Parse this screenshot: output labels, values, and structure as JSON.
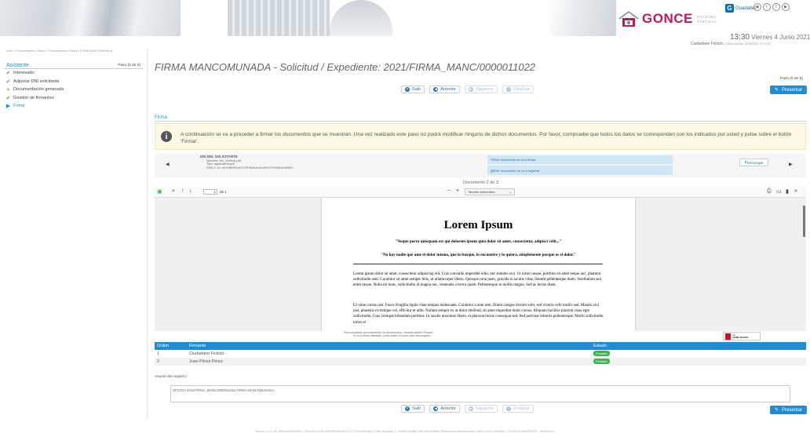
{
  "header": {
    "brand": "GONCE",
    "brand_sub_1": "OFICINA",
    "brand_sub_2": "VIRTUAL",
    "guadaltel": "Guadaltel",
    "guadaltel_icon": "G",
    "social_icons": [
      "rss-icon",
      "twitter-icon",
      "facebook-icon",
      "youtube-icon"
    ],
    "time": "13:30",
    "date": "Viernes 4 Junio 2021",
    "user": "Ciudadano Ficticio",
    "last_access": "| Último acceso: 02/06/2021 17:14:52",
    "breadcrumb": "Inicio » Procedimientos Oficina » Procedimientos Oficina » FIRMA MANCOMUNADA",
    "accent": "#1f8dd6",
    "brand_color": "#c2185b"
  },
  "sidebar": {
    "title": "Asistente",
    "step": "Paso (5 de 5)",
    "items": [
      {
        "label": "Interesado",
        "icon": "check-icon",
        "status": "done"
      },
      {
        "label": "Adjuntar DNI solicitante",
        "icon": "check-icon",
        "status": "done"
      },
      {
        "label": "Documentación generada",
        "icon": "warning-dot-icon",
        "status": "warning"
      },
      {
        "label": "Gestión de firmantes",
        "icon": "check-icon",
        "status": "done"
      },
      {
        "label": "Firma",
        "icon": "play-icon",
        "status": "current"
      }
    ]
  },
  "main": {
    "title": "FIRMA MANCOMUNADA - Solicitud / Expediente: 2021/FIRMA_MANC/0000011022",
    "step": "Paso (5 de 5)",
    "buttons": {
      "salir": "Salir",
      "anterior": "Anterior",
      "siguiente": "Siguiente",
      "finalizar": "Finalizar",
      "presentar": "Presentar"
    },
    "section": "Firma",
    "alert": "A continuación se va a proceder a firmar los documentos que se muestran. Una vez realizado este paso no podrá modificar ninguno de dichos documentos. Por favor, compruebe que todos los datos se corresponden con los indicados por usted y pulse sobre el botón 'Firmar'.",
    "document": {
      "name": "DNI DEL SOLICITANTE",
      "file": "Nombre: dni_Vertical.pdf",
      "type": "Tipo: application/pdf",
      "hash": "SHA-1: m+ok+f9fkXRczECOE9MbolmDxXHzY7HNIDoLWiDk=",
      "firmar": "Este documento se va a firmar",
      "registrar": "Este documento se va a registrar",
      "descargar": "Descargar",
      "counter": "Documento 2 de 3"
    },
    "pdf": {
      "page": "1",
      "of": "de 1",
      "zoom": "Tamaño automático",
      "heading": "Lorem Ipsum",
      "quote1": "\"Neque porro quisquam est qui dolorem ipsum quia dolor sit amet, consectetur, adipisci velit...\"",
      "quote2": "\"No hay nadie que ame el dolor mismo, que lo busque, lo encuentre y lo quiera, simplemente porque es el dolor.\"",
      "para1": "Lorem ipsum dolor sit amet, consectetur adipiscing elit. Cras convallis imperdiet odio, nec sodales orci. Ut tortor neque, porttitor sit amet neque nec, pharetra sollicitudin sem. Curabitur sit amet semper felis, ut ullamcorper libero. Quisque urna justo, gravida in iaculis vitae, blandit pellentesque diam. Vestibulum sed enim neque. Nulla mi nunc, sollicitudin id magna nec, venenatis viverra quam. Pellentesque in mollis magna. Sed ac lectus diam.",
      "para2": "Ut vitae cursus nisl. Fusce fringilla ligula vitae tempus malesuada. Curabitur a ante sem. Etiam congue dictum velit, sed viverra velit mollis sed. Mauris orci nisl, pharetra et tristique vel, efficitur et nibh. Nullam tempor ex ut dolor eleifend, sit amet imperdiet dolor cursus. Aliquam facilisis placerat risus eget sollicitudin. Cras volutpat bibendum porttitor. In iaculis maximus libero, et placerat lectus consequat sed. Sed pulvinar lobortis pellentesque. Morbi sollicitudin tortor et",
      "footer1": "Para visualizar correctamente los documentos, necesita Adobe Reader.",
      "footer2": "Si no lo tiene instalado, pulse sobre el icono para descargarlo.",
      "acrobat1": "Get",
      "acrobat2": "ADOBE READER"
    },
    "table": {
      "headers": [
        "Orden",
        "Firmante",
        "Estado"
      ],
      "rows": [
        [
          "1",
          "Ciudadano Ficticio -",
          "Firmado"
        ],
        [
          "2",
          "Juan Pérez Pérez",
          "Firmado"
        ]
      ]
    },
    "asunto_label": "Asunto del registro:",
    "asunto_value": "OFICINA 2021/FIRMA_MANC/0000011022 FIRMA MANCOMUNADA"
  },
  "footer": "Excmo. D.G. DE ORGANIZACIÓN Y TECNOLOGÍA (DEPARTAMENTO O ORGANISMO) Plaza España, 1. Sevilla Sevilla) Telf: 952349856. Resolución recomendada 1280 x 1024 | Versión: 2.9.0-RC3-SNAPSHOT - 18/05/2021"
}
